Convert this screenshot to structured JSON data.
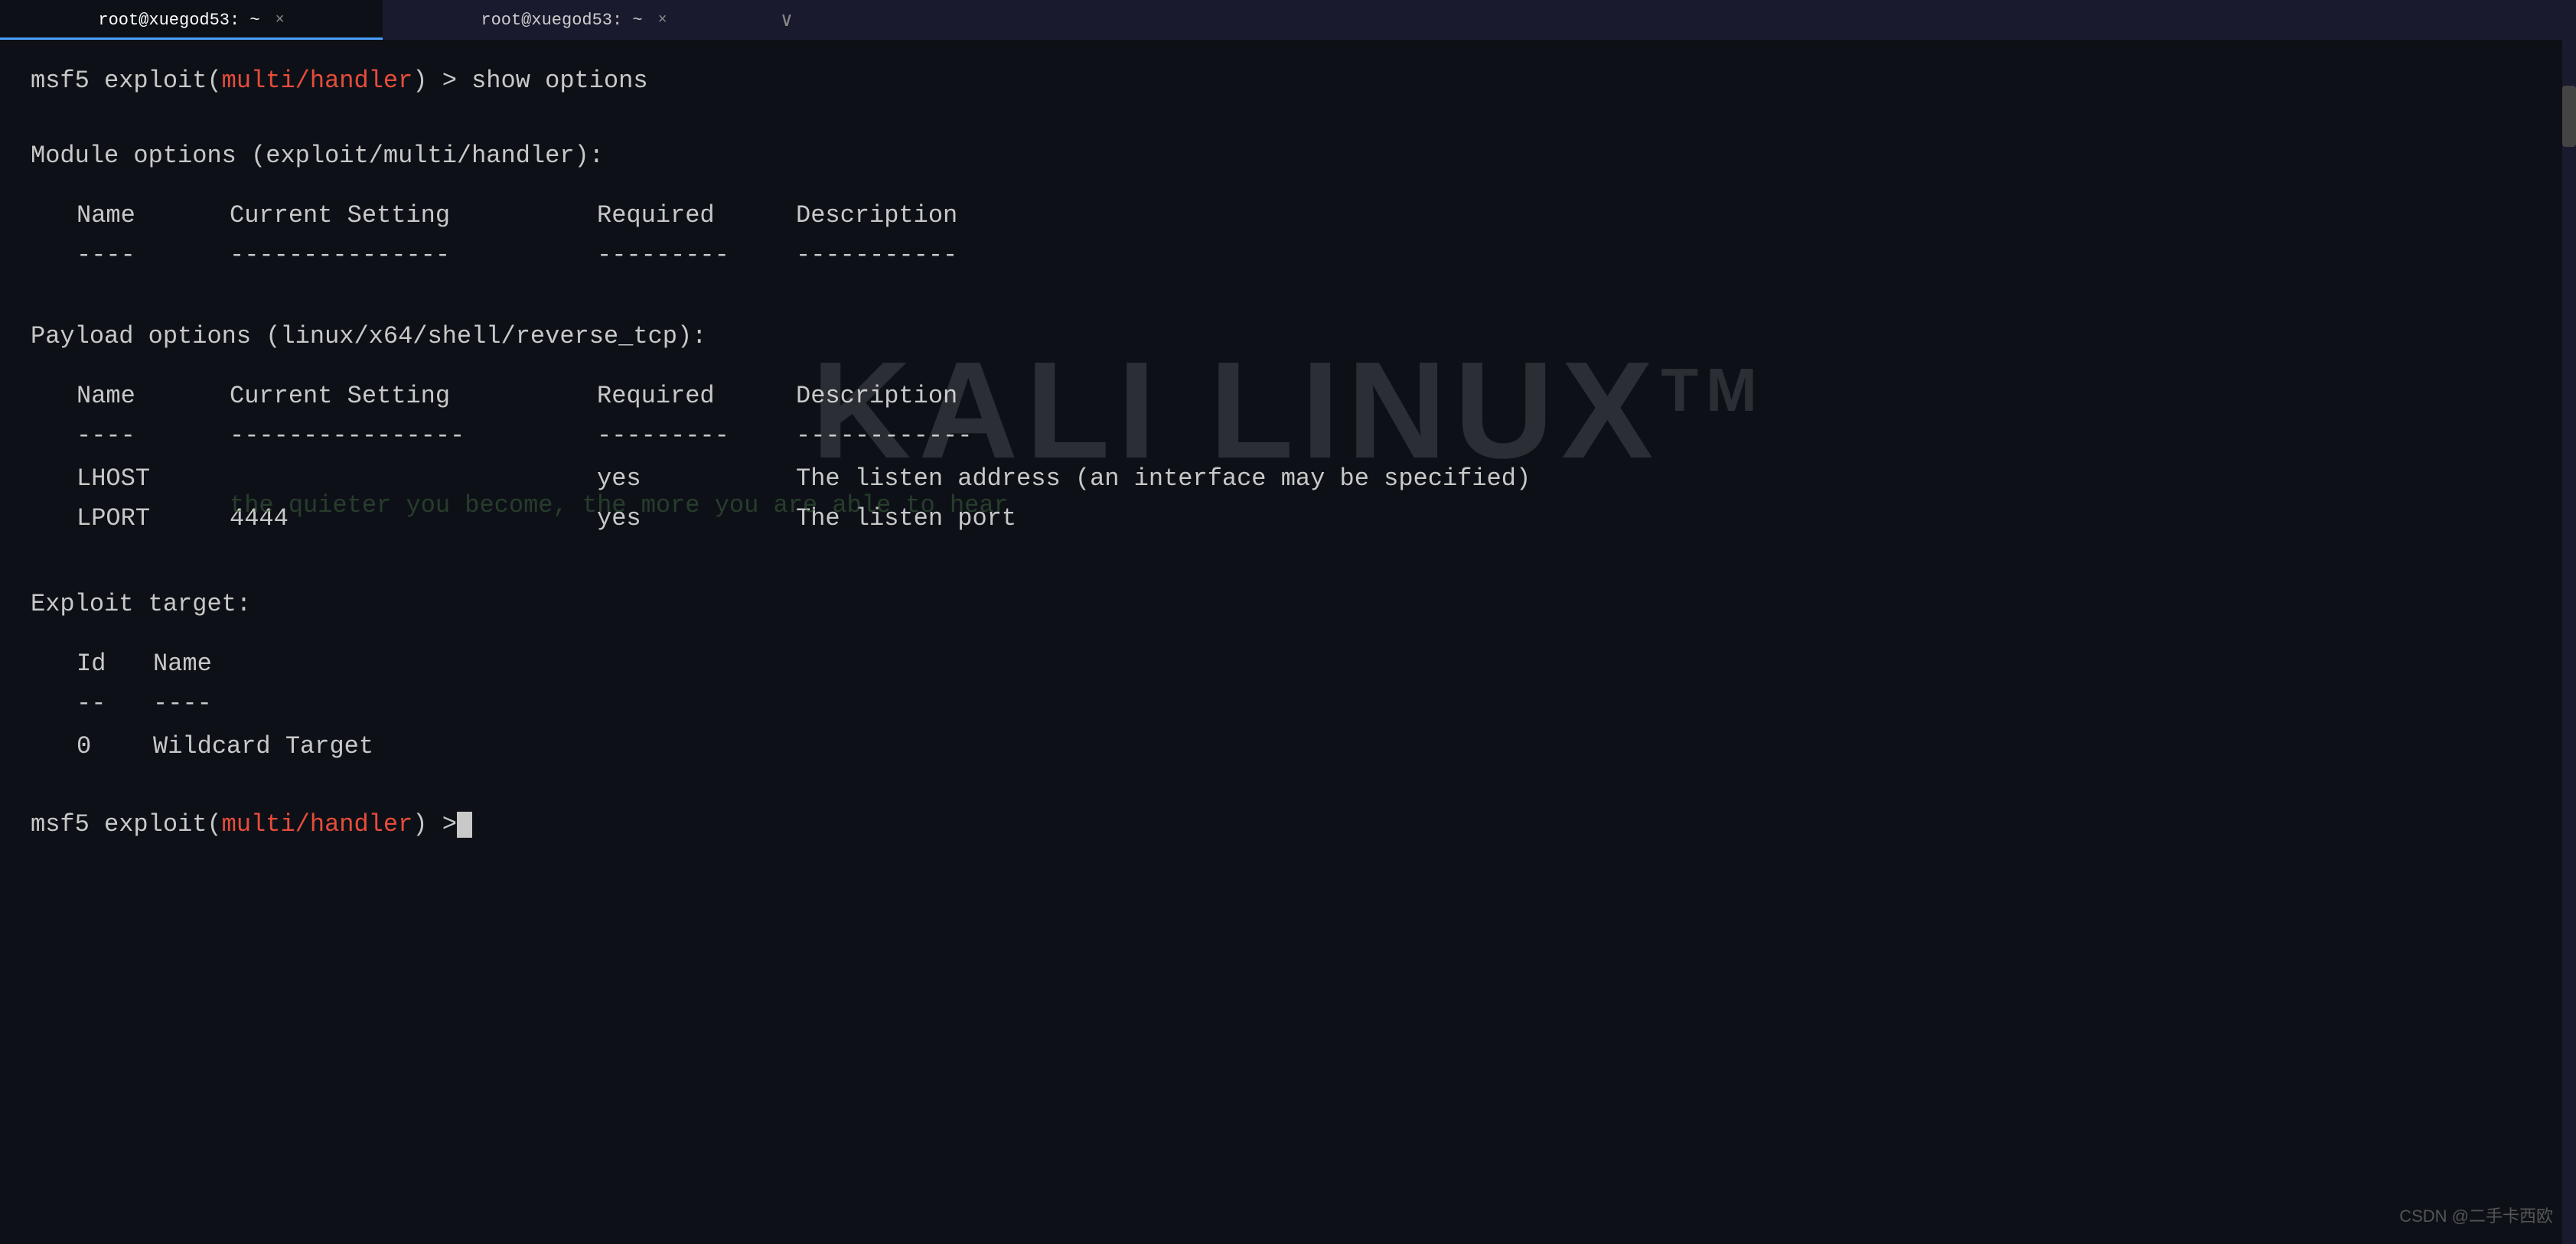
{
  "window": {
    "tab1_label": "root@xuegod53: ~",
    "tab2_label": "root@xuegod53: ~",
    "close_symbol": "×",
    "new_tab_symbol": "∨"
  },
  "terminal": {
    "prompt1": {
      "prefix": "msf5 exploit(",
      "exploit": "multi/handler",
      "suffix": ") > show options"
    },
    "module_options_header": "Module options (exploit/multi/handler):",
    "module_table": {
      "col_name": "Name",
      "col_current": "Current Setting",
      "col_required": "Required",
      "col_description": "Description",
      "sep_name": "----",
      "sep_current": "---------------",
      "sep_required": "---------",
      "sep_description": "-----------",
      "rows": []
    },
    "payload_options_header": "Payload options (linux/x64/shell/reverse_tcp):",
    "payload_table": {
      "col_name": "Name",
      "col_current": "Current Setting",
      "col_required": "Required",
      "col_description": "Description",
      "sep_name": "----",
      "sep_current": "----------------",
      "sep_required": "---------",
      "sep_description": "------------",
      "rows": [
        {
          "name": "LHOST",
          "current": "",
          "required": "yes",
          "description": "The listen address (an interface may be specified)"
        },
        {
          "name": "LPORT",
          "current": "4444",
          "required": "yes",
          "description": "The listen port"
        }
      ]
    },
    "exploit_target_header": "Exploit target:",
    "exploit_table": {
      "col_id": "Id",
      "col_name": "Name",
      "sep_id": "--",
      "sep_name": "----",
      "rows": [
        {
          "id": "0",
          "name": "Wildcard Target"
        }
      ]
    },
    "prompt2": {
      "prefix": "msf5 exploit(",
      "exploit": "multi/handler",
      "suffix": ") > "
    }
  },
  "watermark": {
    "main": "KALI LINUX",
    "tm": "TM",
    "sub": "the quieter you become, the more you are able to hear"
  },
  "csdn": {
    "text": "CSDN @二手卡西欧"
  }
}
